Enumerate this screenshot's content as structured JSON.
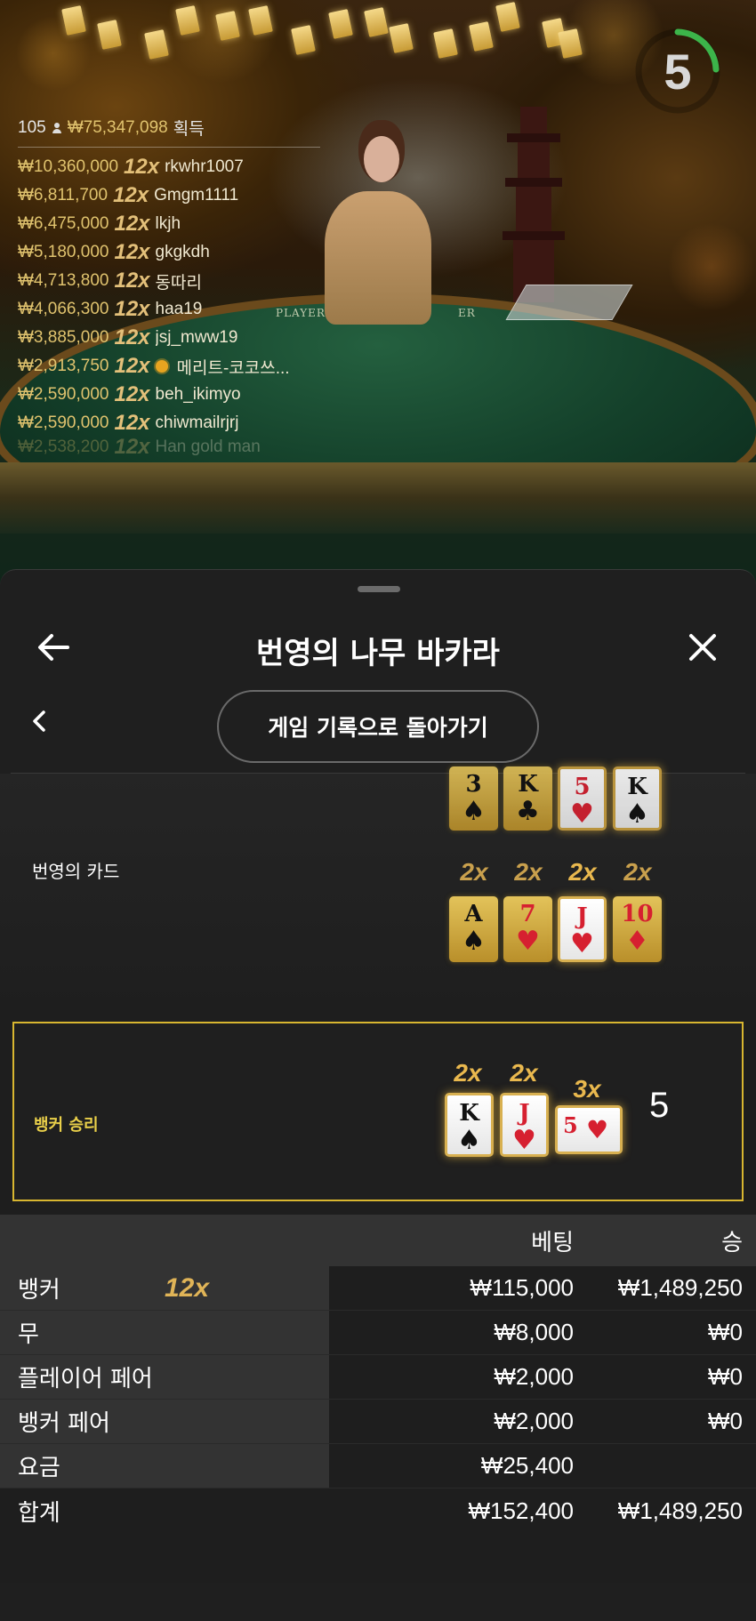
{
  "timer": {
    "value": "5"
  },
  "winners": {
    "count": "105",
    "total": "₩75,347,098",
    "suffix": "획득",
    "rows": [
      {
        "amount": "₩10,360,000",
        "mult": "12x",
        "name": "rkwhr1007"
      },
      {
        "amount": "₩6,811,700",
        "mult": "12x",
        "name": "Gmgm1111"
      },
      {
        "amount": "₩6,475,000",
        "mult": "12x",
        "name": "lkjh"
      },
      {
        "amount": "₩5,180,000",
        "mult": "12x",
        "name": "gkgkdh"
      },
      {
        "amount": "₩4,713,800",
        "mult": "12x",
        "name": "동따리"
      },
      {
        "amount": "₩4,066,300",
        "mult": "12x",
        "name": "haa19"
      },
      {
        "amount": "₩3,885,000",
        "mult": "12x",
        "name": "jsj_mww19"
      },
      {
        "amount": "₩2,913,750",
        "mult": "12x",
        "name": "메리트-코코쓰..."
      },
      {
        "amount": "₩2,590,000",
        "mult": "12x",
        "name": "beh_ikimyo"
      },
      {
        "amount": "₩2,590,000",
        "mult": "12x",
        "name": "chiwmailrjrj"
      },
      {
        "amount": "₩2,538,200",
        "mult": "12x",
        "name": "Han gold man"
      }
    ]
  },
  "table_print": {
    "left": "PLAYER",
    "right": "ER"
  },
  "panel": {
    "title": "번영의 나무 바카라",
    "history_button": "게임 기록으로 돌아가기",
    "prosperity_label": "번영의 카드",
    "top_row": [
      {
        "rank": "3",
        "suit": "♠",
        "color": "black"
      },
      {
        "rank": "K",
        "suit": "♣",
        "color": "black"
      },
      {
        "rank": "5",
        "suit": "♥",
        "color": "red"
      },
      {
        "rank": "K",
        "suit": "♠",
        "color": "black"
      }
    ],
    "mid_row": [
      {
        "mult": "2x",
        "rank": "A",
        "suit": "♠",
        "color": "black"
      },
      {
        "mult": "2x",
        "rank": "7",
        "suit": "♥",
        "color": "red"
      },
      {
        "mult": "2x",
        "rank": "J",
        "suit": "♥",
        "color": "red"
      },
      {
        "mult": "2x",
        "rank": "10",
        "suit": "♦",
        "color": "red"
      }
    ],
    "winner_label": "뱅커 승리",
    "winner_cards": [
      {
        "mult": "2x",
        "rank": "K",
        "suit": "♠",
        "color": "black"
      },
      {
        "mult": "2x",
        "rank": "J",
        "suit": "♥",
        "color": "red"
      },
      {
        "mult": "3x",
        "rank": "5",
        "suit": "♥",
        "color": "red"
      }
    ],
    "score": "5"
  },
  "bets": {
    "header_bet": "베팅",
    "header_win": "승",
    "rows": [
      {
        "label": "뱅커",
        "mult": "12x",
        "bet": "₩115,000",
        "win": "₩1,489,250"
      },
      {
        "label": "무",
        "bet": "₩8,000",
        "win": "₩0"
      },
      {
        "label": "플레이어 페어",
        "bet": "₩2,000",
        "win": "₩0"
      },
      {
        "label": "뱅커 페어",
        "bet": "₩2,000",
        "win": "₩0"
      },
      {
        "label": "요금",
        "bet": "₩25,400",
        "win": ""
      }
    ],
    "total": {
      "label": "합계",
      "bet": "₩152,400",
      "win": "₩1,489,250"
    }
  },
  "colors": {
    "gold": "#e0c36e",
    "winner_border": "#d8b630",
    "timer_ring": "#3cb44a"
  }
}
